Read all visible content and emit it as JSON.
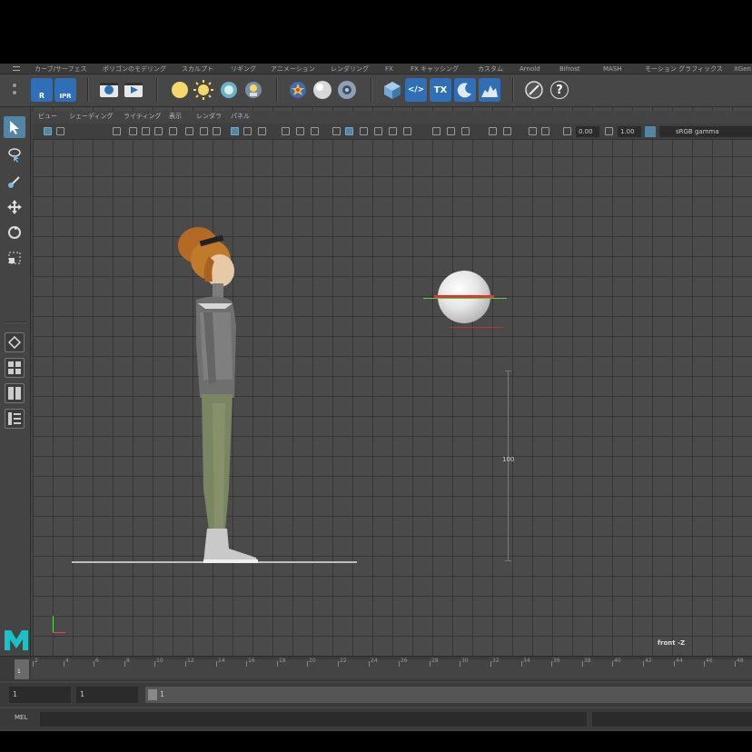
{
  "shelf_tabs": [
    "カーブ/サーフェス",
    "ポリゴンのモデリング",
    "スカルプト",
    "リギング",
    "アニメーション",
    "レンダリング",
    "FX",
    "FX キャッシング",
    "カスタム",
    "Arnold",
    "Bifrost",
    "MASH",
    "モーション グラフィックス",
    "XGen"
  ],
  "shelf_buttons": {
    "render_label": "R",
    "ipr_label": "IPR",
    "tx_label": "TX",
    "code_label": "</>",
    "help_label": "?"
  },
  "panel_menu": [
    "ビュー",
    "シェーディング",
    "ライティング",
    "表示",
    "レンダラ",
    "パネル"
  ],
  "panel_bar": {
    "exposure": "0.00",
    "gamma": "1.00",
    "color_space": "sRGB gamma"
  },
  "viewport": {
    "measure_label": "100",
    "camera_label": "front -Z"
  },
  "timeline": {
    "tick_labels": [
      "2",
      "4",
      "6",
      "8",
      "10",
      "12",
      "14",
      "16",
      "18",
      "20",
      "22",
      "24",
      "26",
      "28",
      "30",
      "32",
      "34",
      "36",
      "38",
      "40",
      "42",
      "44",
      "46",
      "48"
    ],
    "current_frame": "1"
  },
  "range": {
    "start_field": "1",
    "playback_start": "1",
    "slider_label": "1"
  },
  "command": {
    "label": "MEL"
  },
  "colors": {
    "accent": "#5285a6",
    "maya_logo": "#19c1c9",
    "axis_y": "#5bd45b",
    "axis_x": "#e04545"
  }
}
